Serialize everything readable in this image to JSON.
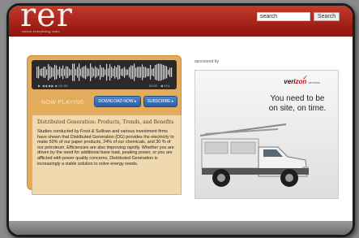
{
  "header": {
    "logo": "rer",
    "tagline": "renew everything radio",
    "search_value": "search",
    "search_button": "Search"
  },
  "player": {
    "controls": "▶ ◀◀ ▶▶ ■ 00:00",
    "time": "00:00",
    "volume": "◀ VOL",
    "now_playing": "NOW PLAYING",
    "download_label": "DOWNLOAD NOW ▸",
    "subscribe_label": "SUBSCRIBE ▸",
    "title": "Distributed Generation: Products, Trends, and Benefits",
    "description": "Studies conducted by Frost & Sullivan and various investment firms have shown that Distributed Generation (DG) provides the electricity to make 50% of our paper products, 24% of our chemicals, and 30 % of our petroleum. Efficiencies are also improving rapidly. Whether you are driven by the need for additional base load, peaking power, or you are afflicted with power quality concerns, Distributed Generation is increasingly a viable solution to solve energy needs."
  },
  "sidebar": {
    "sponsored_label": "sponsored by",
    "ad": {
      "brand_prefix": "veri",
      "brand_mid": "zon",
      "brand_suffix": "wireless",
      "headline": "You need to be on site, on time."
    }
  },
  "colors": {
    "header_red": "#9f1d15",
    "player_orange": "#e3ac5c",
    "button_blue": "#2a5ea6",
    "brand_red": "#d10f12"
  }
}
